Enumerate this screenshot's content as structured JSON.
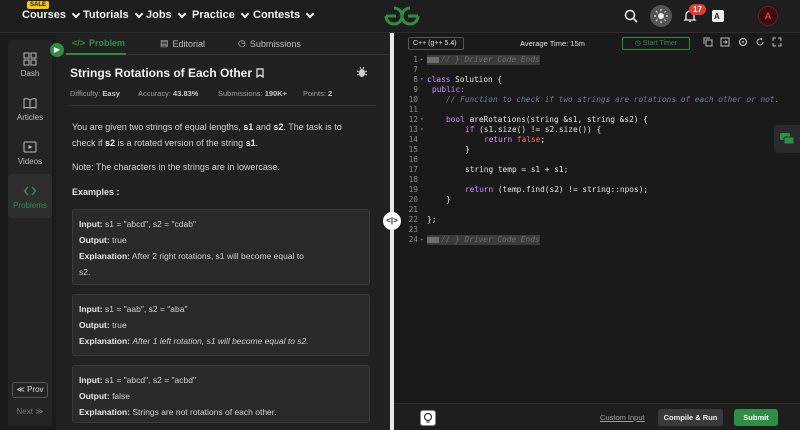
{
  "nav": {
    "sale_badge": "SALE",
    "items": [
      "Courses",
      "Tutorials",
      "Jobs",
      "Practice",
      "Contests"
    ],
    "notifications_count": "17",
    "avatar_letter": "A",
    "brand_color": "#2f8d46"
  },
  "sidebar": {
    "items": [
      "Dash",
      "Articles",
      "Videos",
      "Problems"
    ],
    "prev": "≪ Prov",
    "next": "Next ≫"
  },
  "tabs": {
    "problem": "Problem",
    "editorial": "Editorial",
    "submissions": "Submissions"
  },
  "problem": {
    "title": "Strings Rotations of Each Other",
    "difficulty_label": "Difficulty:",
    "difficulty": "Easy",
    "accuracy_label": "Accuracy:",
    "accuracy": "43.83%",
    "submissions_label": "Submissions:",
    "submissions": "190K+",
    "points_label": "Points:",
    "points": "2",
    "desc_1a": "You are given two strings of equal lengths,",
    "desc_s1": "s1",
    "desc_and": "and",
    "desc_s2": "s2",
    "desc_1b": ". The task is to",
    "desc_2a": "check if",
    "desc_2b": "is a rotated version of the string",
    "desc_period": ".",
    "note": "Note: The characters in the strings are in lowercase.",
    "examples_label": "Examples :",
    "input_label": "Input:",
    "output_label": "Output:",
    "explanation_label": "Explanation:",
    "examples": [
      {
        "input": "s1 = \"abcd\", s2 = \"cdab\"",
        "output": "true",
        "explanation_a": "After 2 right rotations, s1 will become equal to",
        "explanation_b": "s2."
      },
      {
        "input": "s1 = \"aab\", s2 = \"aba\"",
        "output": "true",
        "explanation_a": "After 1 left rotation, s1 will become equal to s2."
      },
      {
        "input": "s1 = \"abcd\", s2 = \"acbd\"",
        "output": "false",
        "explanation_a": "Strings are not rotations of each other."
      }
    ]
  },
  "editor": {
    "language": "C++ (g++ 5.4)",
    "average_time": "Average Time: 15m",
    "start_timer": "Start Timer",
    "custom_input": "Custom Input",
    "compile_run": "Compile & Run",
    "submit": "Submit",
    "line_numbers": [
      "1",
      "7",
      "8",
      "9",
      "10",
      "11",
      "12",
      "13",
      "14",
      "15",
      "16",
      "17",
      "18",
      "19",
      "20",
      "21",
      "22",
      "23",
      "24"
    ],
    "code": {
      "l1": "// } Driver Code Ends",
      "l8a": "class",
      "l8b": " Solution {",
      "l9": "public:",
      "l10": "// Function to check if two strings are rotations of each other or not.",
      "l12a": "bool",
      "l12b": " areRotations(string &s1, string &s2) {",
      "l13a": "if",
      "l13b": " (s1.size() != s2.size()) {",
      "l14a": "return",
      "l14b": "false",
      "l14c": ";",
      "l15": "}",
      "l17": "string temp = s1 + s1;",
      "l19a": "return",
      "l19b": " (temp.find(s2) != string::npos);",
      "l20": "}",
      "l22": "};",
      "l24": "// } Driver Code Ends"
    }
  }
}
